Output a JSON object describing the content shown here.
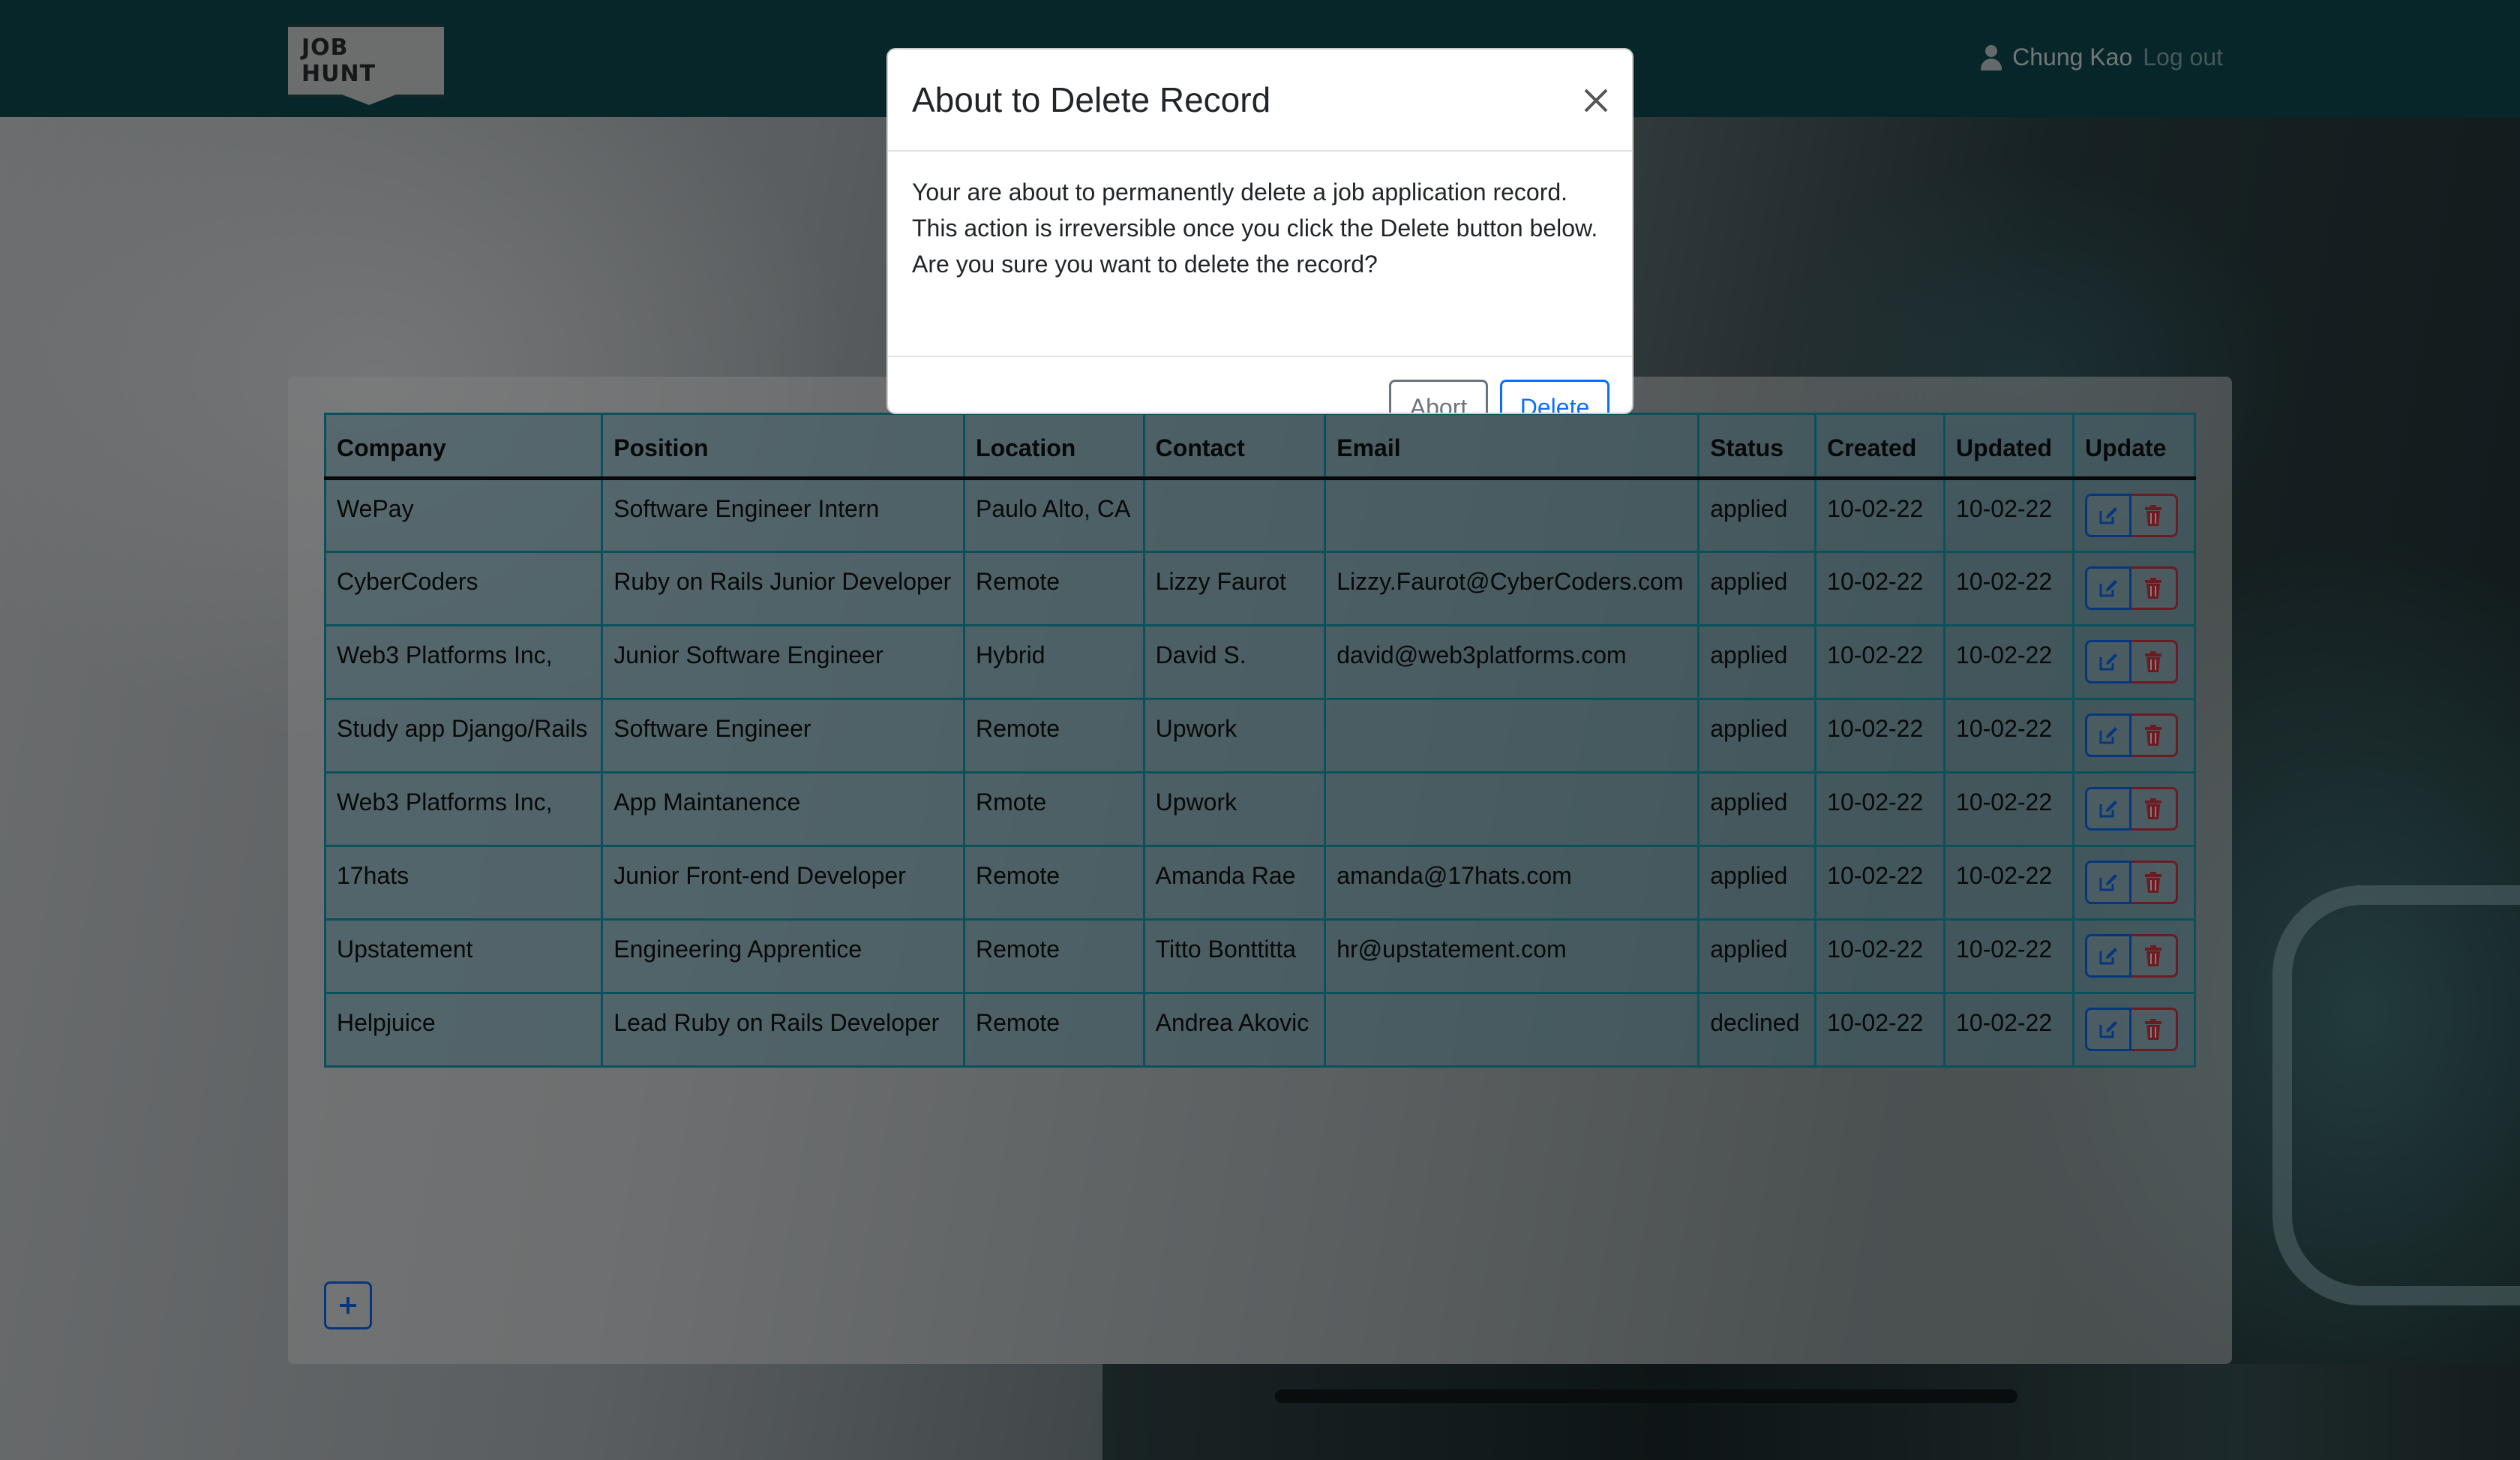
{
  "brand": {
    "logo_text": "JOB HUNT"
  },
  "user": {
    "name": "Chung Kao",
    "logout": "Log out"
  },
  "table": {
    "columns": [
      "Company",
      "Position",
      "Location",
      "Contact",
      "Email",
      "Status",
      "Created",
      "Updated",
      "Update"
    ],
    "rows": [
      {
        "company": "WePay",
        "position": "Software Engineer Intern",
        "location": "Paulo Alto, CA",
        "contact": "",
        "email": "",
        "status": "applied",
        "created": "10-02-22",
        "updated": "10-02-22"
      },
      {
        "company": "CyberCoders",
        "position": "Ruby on Rails Junior Developer",
        "location": "Remote",
        "contact": "Lizzy Faurot",
        "email": "Lizzy.Faurot@CyberCoders.com",
        "status": "applied",
        "created": "10-02-22",
        "updated": "10-02-22"
      },
      {
        "company": "Web3 Platforms Inc,",
        "position": "Junior Software Engineer",
        "location": "Hybrid",
        "contact": "David S.",
        "email": "david@web3platforms.com",
        "status": "applied",
        "created": "10-02-22",
        "updated": "10-02-22"
      },
      {
        "company": "Study app Django/Rails",
        "position": "Software Engineer",
        "location": "Remote",
        "contact": "Upwork",
        "email": "",
        "status": "applied",
        "created": "10-02-22",
        "updated": "10-02-22"
      },
      {
        "company": "Web3 Platforms Inc,",
        "position": "App Maintanence",
        "location": "Rmote",
        "contact": "Upwork",
        "email": "",
        "status": "applied",
        "created": "10-02-22",
        "updated": "10-02-22"
      },
      {
        "company": "17hats",
        "position": "Junior Front-end Developer",
        "location": "Remote",
        "contact": "Amanda Rae",
        "email": "amanda@17hats.com",
        "status": "applied",
        "created": "10-02-22",
        "updated": "10-02-22"
      },
      {
        "company": "Upstatement",
        "position": "Engineering Apprentice",
        "location": "Remote",
        "contact": "Titto Bonttitta",
        "email": "hr@upstatement.com",
        "status": "applied",
        "created": "10-02-22",
        "updated": "10-02-22"
      },
      {
        "company": "Helpjuice",
        "position": "Lead Ruby on Rails Developer",
        "location": "Remote",
        "contact": "Andrea Akovic",
        "email": "",
        "status": "declined",
        "created": "10-02-22",
        "updated": "10-02-22"
      }
    ]
  },
  "modal": {
    "title": "About to Delete Record",
    "body": "Your are about to permanently delete a job application record. This action is irreversible once you click the Delete button below. Are you sure you want to delete the record?",
    "abort_label": "Abort",
    "delete_label": "Delete"
  },
  "icons": {
    "close": "close-icon",
    "edit": "edit-icon",
    "delete": "trash-icon",
    "add": "plus-icon",
    "user": "user-icon"
  },
  "colors": {
    "navbar": "#0d4d55",
    "primary": "#0d6efd",
    "danger": "#dc3545",
    "table_border": "#17a2b8"
  }
}
